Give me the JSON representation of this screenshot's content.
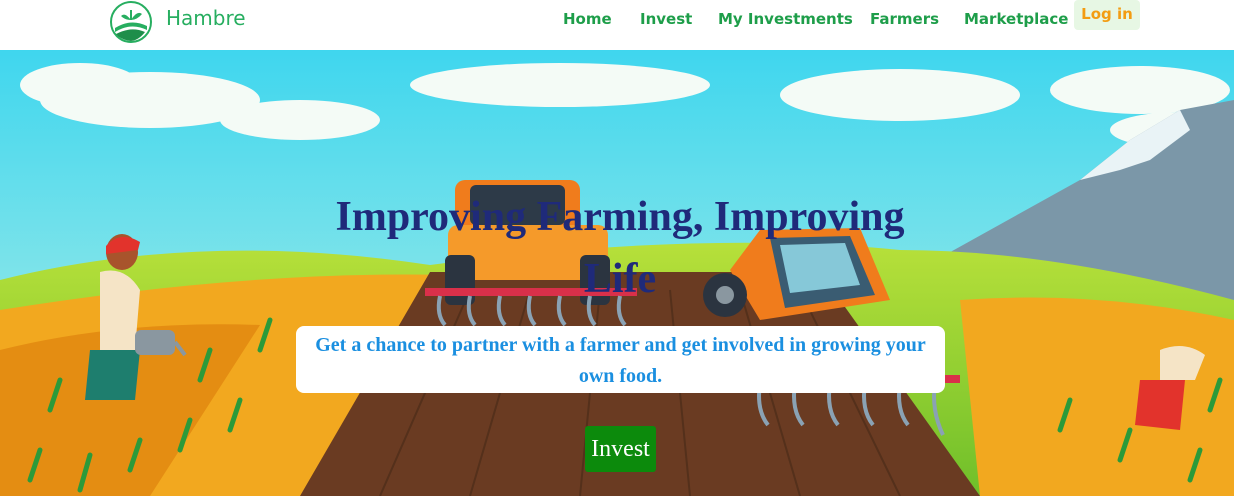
{
  "brand": {
    "name": "Hambre",
    "logo_icon": "leaf-field-logo-icon"
  },
  "nav": {
    "items": [
      {
        "label": "Home"
      },
      {
        "label": "Invest"
      },
      {
        "label": "My Investments"
      },
      {
        "label": "Farmers"
      },
      {
        "label": "Marketplace"
      }
    ],
    "login_label": "Log in"
  },
  "hero": {
    "headline": "Improving Farming, Improving Life",
    "subtitle": "Get a chance to partner with a farmer and get involved in growing your own food.",
    "cta_label": "Invest",
    "background_illustration": "farm-tractors-illustration"
  },
  "colors": {
    "nav_link": "#1e9e4a",
    "login": "#f39c12",
    "headline": "#1f2a7a",
    "subtitle": "#1a8fe0",
    "cta_bg": "#0c8a0c"
  }
}
